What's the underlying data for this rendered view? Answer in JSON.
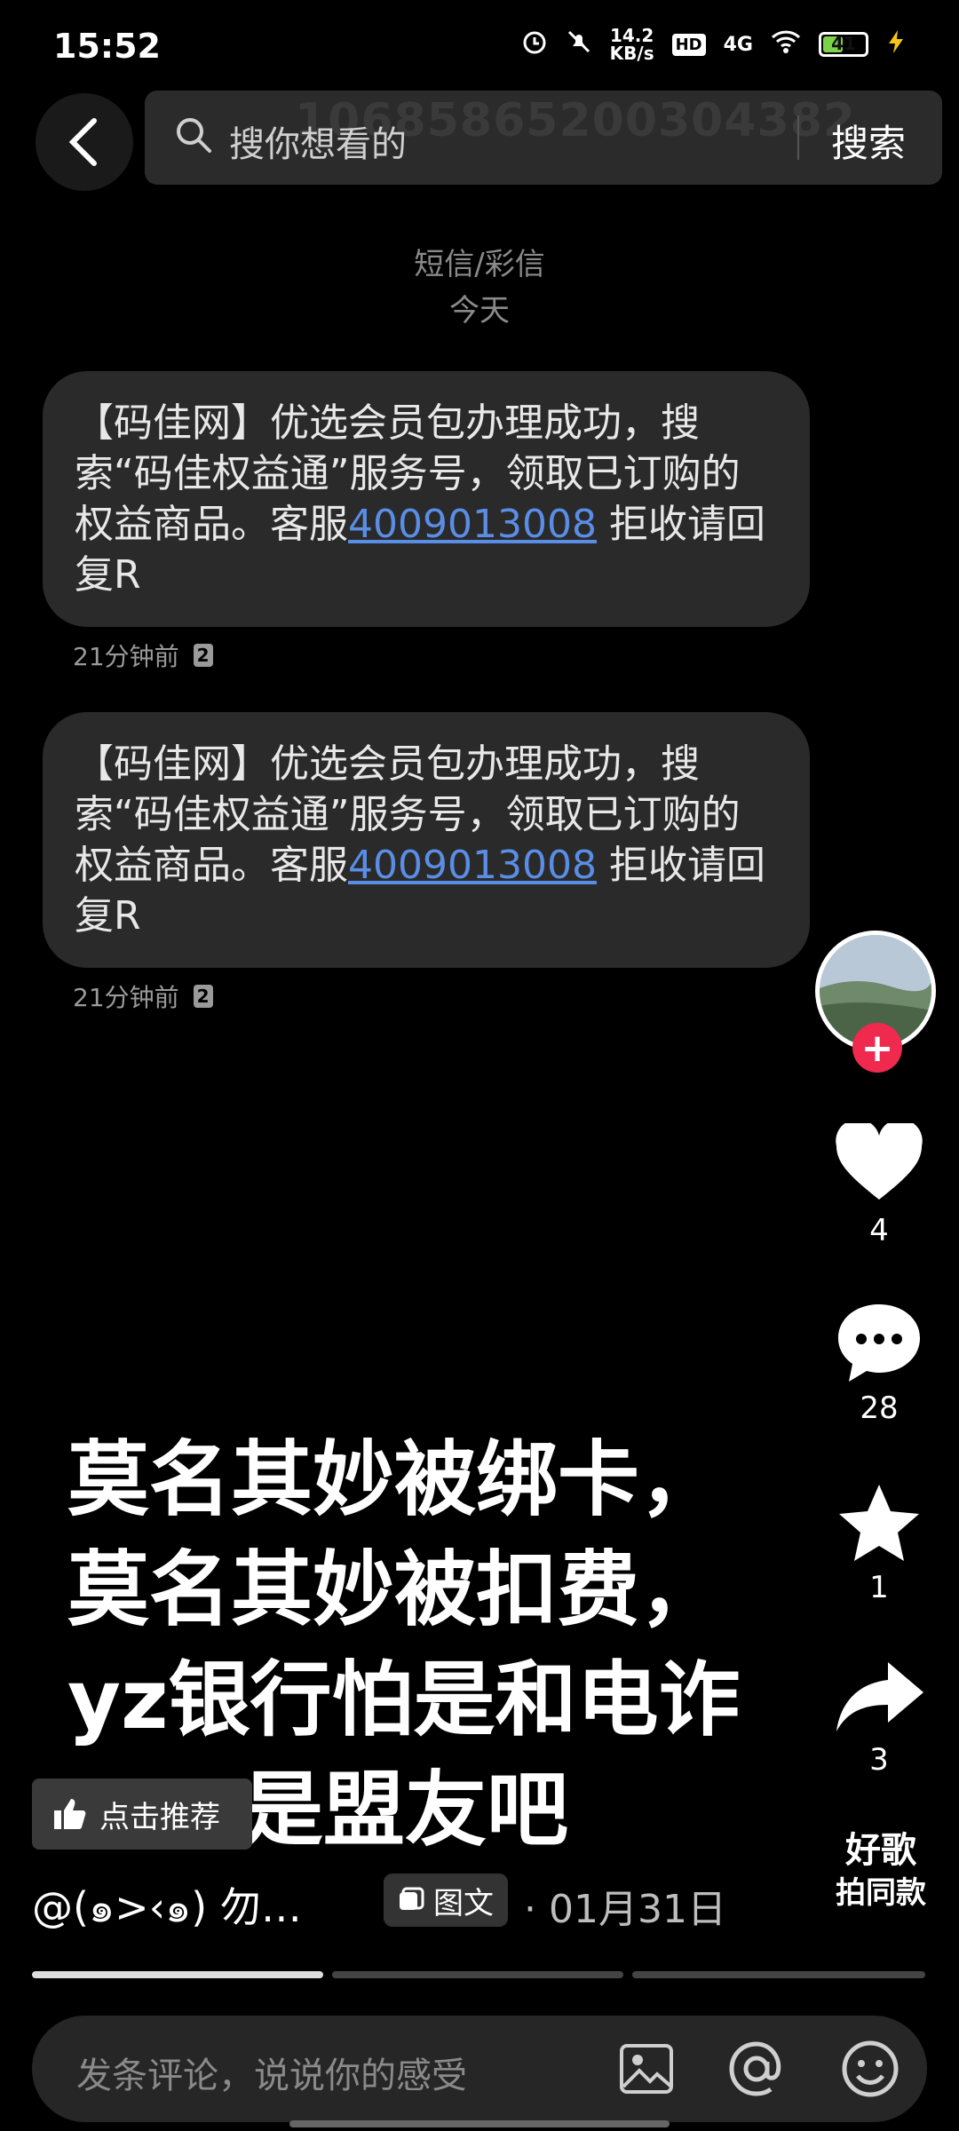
{
  "status_bar": {
    "time": "15:52",
    "net_speed_value": "14.2",
    "net_speed_unit": "KB/s",
    "hd": "HD",
    "network": "4G",
    "battery": "41"
  },
  "search": {
    "placeholder": "搜你想看的",
    "button": "搜索"
  },
  "sms": {
    "number": "10685865200304382",
    "type_label": "短信/彩信",
    "day_label": "今天",
    "messages": [
      {
        "text_before": "【码佳网】优选会员包办理成功，搜索“码佳权益通”服务号，领取已订购的权益商品。客服",
        "phone": "4009013008",
        "text_after": " 拒收请回复R",
        "time": "21分钟前",
        "sim": "2"
      },
      {
        "text_before": "【码佳网】优选会员包办理成功，搜索“码佳权益通”服务号，领取已订购的权益商品。客服",
        "phone": "4009013008",
        "text_after": " 拒收请回复R",
        "time": "21分钟前",
        "sim": "2"
      }
    ]
  },
  "actions": {
    "likes": "4",
    "comments": "28",
    "favorites": "1",
    "shares": "3"
  },
  "caption": {
    "line1": "莫名其妙被绑卡，",
    "line2": "莫名其妙被扣费，",
    "line3": "yz银行怕是和电诈",
    "line4": "是盟友吧"
  },
  "recommend_label": "点击推荐",
  "music": {
    "line1": "好歌",
    "line2": "拍同款"
  },
  "post": {
    "author": "@(๑>‹๑) 勿…",
    "type": "图文",
    "date": "· 01月31日"
  },
  "comment": {
    "placeholder": "发条评论，说说你的感受"
  },
  "progress": {
    "segments": 3,
    "active_index": 0
  },
  "colors": {
    "link": "#5a8ee6",
    "follow": "#f0294f",
    "bubble": "#2a2a2a"
  }
}
